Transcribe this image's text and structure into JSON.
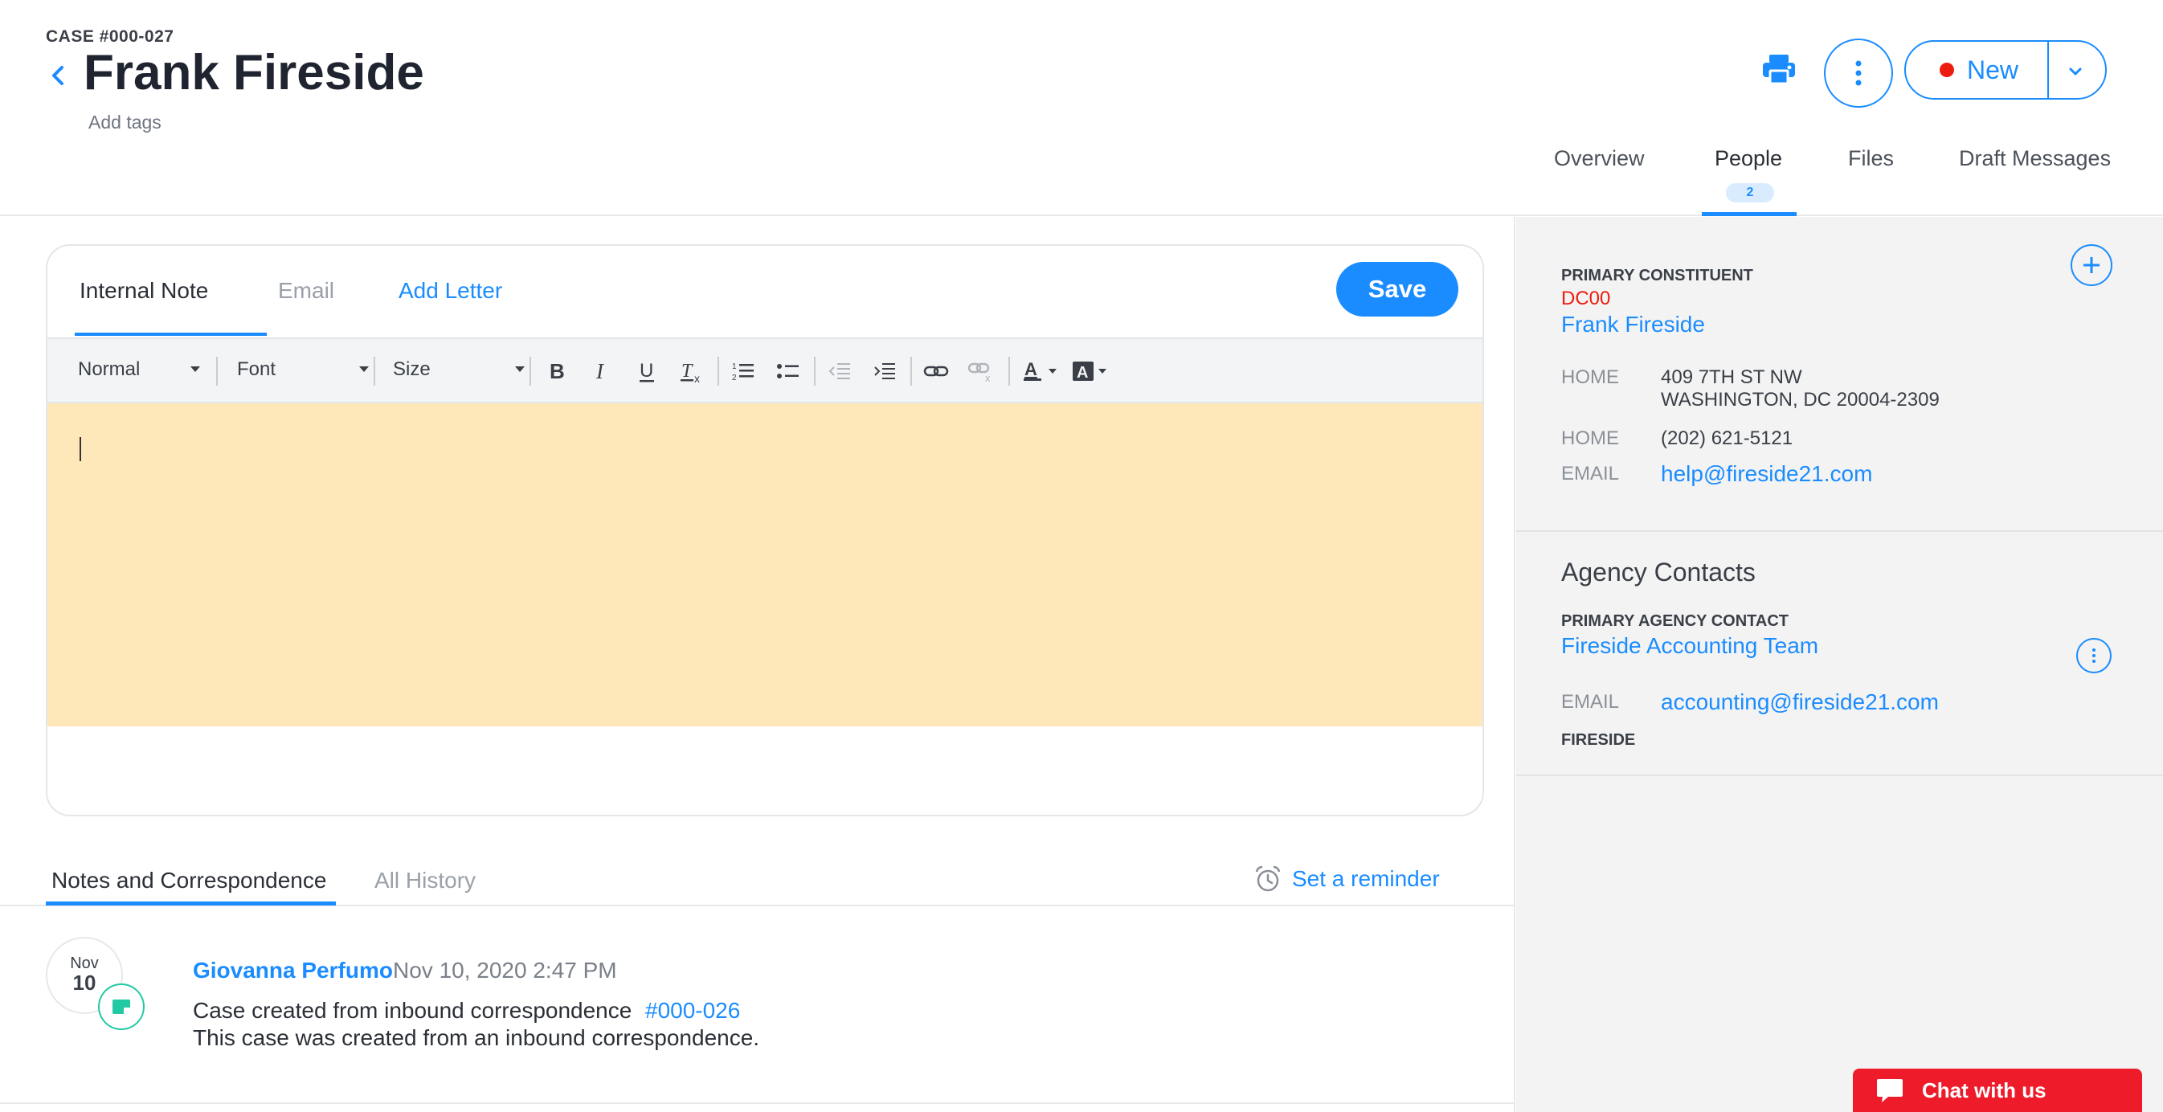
{
  "header": {
    "case_id": "CASE #000-027",
    "title": "Frank Fireside",
    "add_tags": "Add tags",
    "new_button_label": "New",
    "tabs": [
      {
        "label": "Overview"
      },
      {
        "label": "People",
        "badge": "2"
      },
      {
        "label": "Files"
      },
      {
        "label": "Draft Messages"
      }
    ],
    "active_tab": "People"
  },
  "editor": {
    "tabs": [
      {
        "label": "Internal Note"
      },
      {
        "label": "Email"
      },
      {
        "label": "Add Letter"
      }
    ],
    "active_tab": "Internal Note",
    "save_label": "Save",
    "toolbar": {
      "format": "Normal",
      "font": "Font",
      "size": "Size"
    },
    "content": ""
  },
  "notes": {
    "tabs": [
      {
        "label": "Notes and Correspondence"
      },
      {
        "label": "All History"
      }
    ],
    "active_tab": "Notes and Correspondence",
    "reminder_label": "Set a reminder",
    "entries": [
      {
        "month": "Nov",
        "day": "10",
        "author": "Giovanna Perfumo",
        "timestamp": "Nov 10, 2020 2:47 PM",
        "line1_text": "Case created from inbound correspondence",
        "line1_link": "#000-026",
        "line2": "This case was created from an inbound correspondence."
      }
    ]
  },
  "constituent": {
    "section_label": "PRIMARY CONSTITUENT",
    "code": "DC00",
    "name": "Frank Fireside",
    "address_label": "HOME",
    "address_line1": "409 7TH ST NW",
    "address_line2": "WASHINGTON, DC 20004-2309",
    "phone_label": "HOME",
    "phone": "(202) 621-5121",
    "email_label": "EMAIL",
    "email": "help@fireside21.com"
  },
  "agency": {
    "heading": "Agency Contacts",
    "section_label": "PRIMARY AGENCY CONTACT",
    "name": "Fireside Accounting Team",
    "email_label": "EMAIL",
    "email": "accounting@fireside21.com",
    "org": "FIRESIDE"
  },
  "chat": {
    "label": "Chat with us"
  },
  "colors": {
    "accent": "#1a8cff",
    "editor_bg": "#fee8b9",
    "panel_bg": "#f3f3f3",
    "alert_red": "#ee1c0e",
    "chat_red": "#ee1c2b",
    "badge_teal": "#22c9a2"
  }
}
